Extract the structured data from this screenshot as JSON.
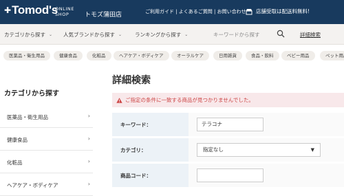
{
  "header": {
    "logo": "Tomod's",
    "shop_line1": "ONLINE",
    "shop_line2": "SHOP",
    "store_name": "トモズ蒲田店",
    "links": "ご利用ガイド | よくあるご質問 | お問い合わせ",
    "store_notice": "店舗受取は配送料無料!"
  },
  "nav": {
    "category": "カテゴリから探す",
    "brand": "人気ブランドから探す",
    "ranking": "ランキングから探す",
    "search_placeholder": "キーワードから探す",
    "detail_search": "詳細検索"
  },
  "categories": [
    "医薬品・衛生用品",
    "健康食品",
    "化粧品",
    "ヘアケア・ボディケア",
    "オーラルケア",
    "日用雑貨",
    "食品・飲料",
    "ベビー用品",
    "ペット用品"
  ],
  "sidebar": {
    "title": "カテゴリから探す",
    "items": [
      "医薬品・衛生用品",
      "健康食品",
      "化粧品",
      "ヘアケア・ボディケア"
    ]
  },
  "main": {
    "title": "詳細検索",
    "alert": "ご指定の条件に一致する商品が見つかりませんでした。",
    "keyword_label": "キーワード：",
    "keyword_value": "テラコナ",
    "category_label": "カテゴリ：",
    "category_value": "指定なし",
    "code_label": "商品コード：",
    "code_value": ""
  },
  "colors": {
    "header_bg": "#183a5e",
    "nav_bg": "#f4f2f0",
    "alert_bg": "#f8e8ea",
    "alert_text": "#cc4444",
    "form_label_bg": "#ecf2f7"
  }
}
